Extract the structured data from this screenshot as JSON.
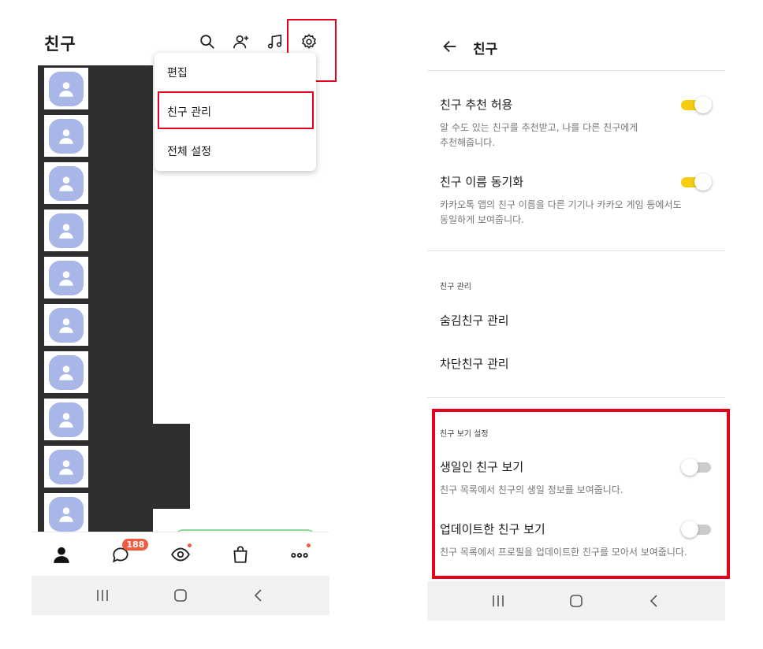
{
  "left": {
    "title": "친구",
    "menu": [
      "편집",
      "친구 관리",
      "전체 설정"
    ],
    "chat_badge": "188",
    "avatar_count": 10
  },
  "right": {
    "title": "친구",
    "settings": [
      {
        "title": "친구 추천 허용",
        "desc": "알 수도 있는 친구를 추천받고, 나를 다른 친구에게\n추천해줍니다.",
        "enabled": true
      },
      {
        "title": "친구 이름 동기화",
        "desc": "카카오톡 앱의 친구 이름을 다른 기기나 카카오 게임 등에서도\n동일하게 보여줍니다.",
        "enabled": true
      }
    ],
    "manage_section": {
      "label": "친구 관리",
      "items": [
        "숨김친구 관리",
        "차단친구 관리"
      ]
    },
    "view_section": {
      "label": "친구 보기 설정",
      "items": [
        {
          "title": "생일인 친구 보기",
          "desc": "친구 목록에서 친구의 생일 정보를 보여줍니다.",
          "enabled": false
        },
        {
          "title": "업데이트한 친구 보기",
          "desc": "친구 목록에서 프로필을 업데이트한 친구를 모아서 보여줍니다.",
          "enabled": false
        }
      ]
    }
  },
  "colors": {
    "highlight": "#e8001c",
    "toggle_on": "#f5cd0e",
    "avatar": "#a9b6e8",
    "badge": "#f05a41"
  }
}
